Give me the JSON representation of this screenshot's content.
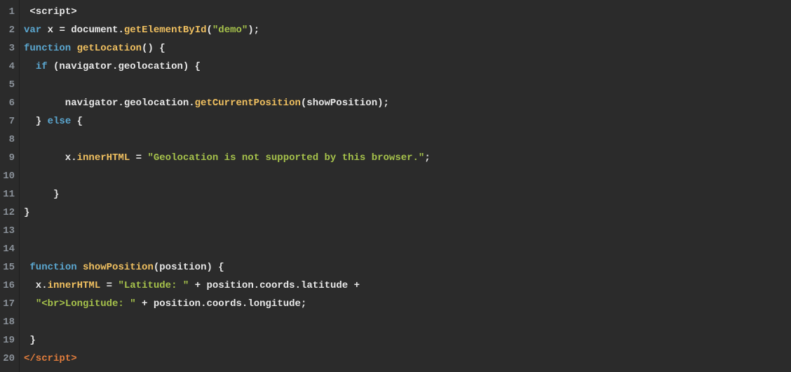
{
  "lines": [
    {
      "n": "1",
      "seg": [
        {
          "t": " ",
          "c": "pn"
        },
        {
          "t": "<script>",
          "c": "tag"
        }
      ]
    },
    {
      "n": "2",
      "seg": [
        {
          "t": "var",
          "c": "kw"
        },
        {
          "t": " x ",
          "c": "id"
        },
        {
          "t": "=",
          "c": "op"
        },
        {
          "t": " document",
          "c": "id"
        },
        {
          "t": ".",
          "c": "op"
        },
        {
          "t": "getElementById",
          "c": "fn"
        },
        {
          "t": "(",
          "c": "pn"
        },
        {
          "t": "\"demo\"",
          "c": "str"
        },
        {
          "t": ");",
          "c": "pn"
        }
      ]
    },
    {
      "n": "3",
      "seg": [
        {
          "t": "function",
          "c": "kw"
        },
        {
          "t": " ",
          "c": "pn"
        },
        {
          "t": "getLocation",
          "c": "fn"
        },
        {
          "t": "() {",
          "c": "pn"
        }
      ]
    },
    {
      "n": "4",
      "seg": [
        {
          "t": "  ",
          "c": "pn"
        },
        {
          "t": "if",
          "c": "kw"
        },
        {
          "t": " (navigator",
          "c": "id"
        },
        {
          "t": ".",
          "c": "op"
        },
        {
          "t": "geolocation) {",
          "c": "id"
        }
      ]
    },
    {
      "n": "5",
      "seg": [
        {
          "t": "",
          "c": "pn"
        }
      ]
    },
    {
      "n": "6",
      "seg": [
        {
          "t": "       navigator",
          "c": "id"
        },
        {
          "t": ".",
          "c": "op"
        },
        {
          "t": "geolocation",
          "c": "id"
        },
        {
          "t": ".",
          "c": "op"
        },
        {
          "t": "getCurrentPosition",
          "c": "fn"
        },
        {
          "t": "(showPosition);",
          "c": "id"
        }
      ]
    },
    {
      "n": "7",
      "seg": [
        {
          "t": "  } ",
          "c": "pn"
        },
        {
          "t": "else",
          "c": "kw"
        },
        {
          "t": " {",
          "c": "pn"
        }
      ]
    },
    {
      "n": "8",
      "seg": [
        {
          "t": "",
          "c": "pn"
        }
      ]
    },
    {
      "n": "9",
      "seg": [
        {
          "t": "       x",
          "c": "id"
        },
        {
          "t": ".",
          "c": "op"
        },
        {
          "t": "innerHTML",
          "c": "fn"
        },
        {
          "t": " ",
          "c": "pn"
        },
        {
          "t": "=",
          "c": "op"
        },
        {
          "t": " ",
          "c": "pn"
        },
        {
          "t": "\"Geolocation is not supported by this browser.\"",
          "c": "str"
        },
        {
          "t": ";",
          "c": "pn"
        }
      ]
    },
    {
      "n": "10",
      "seg": [
        {
          "t": "",
          "c": "pn"
        }
      ]
    },
    {
      "n": "11",
      "seg": [
        {
          "t": "     }",
          "c": "pn"
        }
      ]
    },
    {
      "n": "12",
      "seg": [
        {
          "t": "}",
          "c": "pn"
        }
      ]
    },
    {
      "n": "13",
      "seg": [
        {
          "t": "",
          "c": "pn"
        }
      ]
    },
    {
      "n": "14",
      "seg": [
        {
          "t": "",
          "c": "pn"
        }
      ]
    },
    {
      "n": "15",
      "seg": [
        {
          "t": " ",
          "c": "pn"
        },
        {
          "t": "function",
          "c": "kw"
        },
        {
          "t": " ",
          "c": "pn"
        },
        {
          "t": "showPosition",
          "c": "fn"
        },
        {
          "t": "(position) {",
          "c": "id"
        }
      ]
    },
    {
      "n": "16",
      "seg": [
        {
          "t": "  x",
          "c": "id"
        },
        {
          "t": ".",
          "c": "op"
        },
        {
          "t": "innerHTML",
          "c": "fn"
        },
        {
          "t": " ",
          "c": "pn"
        },
        {
          "t": "=",
          "c": "op"
        },
        {
          "t": " ",
          "c": "pn"
        },
        {
          "t": "\"Latitude: \"",
          "c": "str"
        },
        {
          "t": " ",
          "c": "pn"
        },
        {
          "t": "+",
          "c": "op"
        },
        {
          "t": " position",
          "c": "id"
        },
        {
          "t": ".",
          "c": "op"
        },
        {
          "t": "coords",
          "c": "id"
        },
        {
          "t": ".",
          "c": "op"
        },
        {
          "t": "latitude ",
          "c": "id"
        },
        {
          "t": "+",
          "c": "op"
        }
      ]
    },
    {
      "n": "17",
      "seg": [
        {
          "t": "  ",
          "c": "pn"
        },
        {
          "t": "\"<br>Longitude: \"",
          "c": "str"
        },
        {
          "t": " ",
          "c": "pn"
        },
        {
          "t": "+",
          "c": "op"
        },
        {
          "t": " position",
          "c": "id"
        },
        {
          "t": ".",
          "c": "op"
        },
        {
          "t": "coords",
          "c": "id"
        },
        {
          "t": ".",
          "c": "op"
        },
        {
          "t": "longitude;",
          "c": "id"
        }
      ]
    },
    {
      "n": "18",
      "seg": [
        {
          "t": "",
          "c": "pn"
        }
      ]
    },
    {
      "n": "19",
      "seg": [
        {
          "t": " }",
          "c": "pn"
        }
      ]
    },
    {
      "n": "20",
      "seg": [
        {
          "t": "</scr",
          "c": "closetag"
        },
        {
          "t": "ipt>",
          "c": "closetag"
        }
      ]
    }
  ]
}
